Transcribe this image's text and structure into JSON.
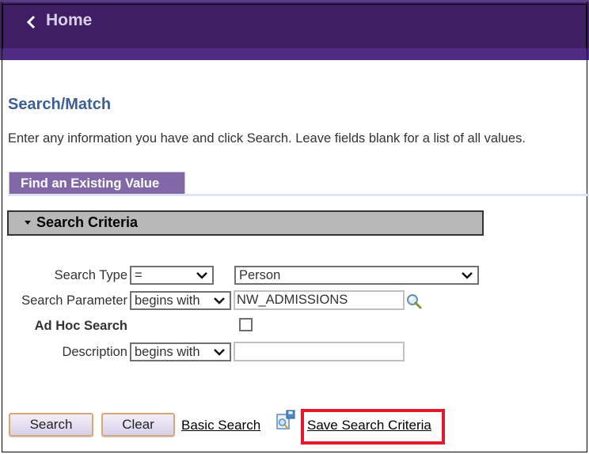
{
  "header": {
    "back_icon": "chevron-left-icon",
    "home_label": "Home"
  },
  "page": {
    "title": "Search/Match",
    "instructions": "Enter any information you have and click Search. Leave fields blank for a list of all values."
  },
  "tabs": [
    {
      "label": "Find an Existing Value",
      "active": true
    }
  ],
  "search_criteria": {
    "section_label": "Search Criteria",
    "expanded": true,
    "fields": {
      "search_type": {
        "label": "Search Type",
        "operator": "=",
        "value": "Person"
      },
      "search_parameter": {
        "label": "Search Parameter",
        "operator": "begins with",
        "value": "NW_ADMISSIONS",
        "lookup_icon": "magnifier-icon"
      },
      "ad_hoc_search": {
        "label": "Ad Hoc Search",
        "checked": false
      },
      "description": {
        "label": "Description",
        "operator": "begins with",
        "value": ""
      }
    }
  },
  "actions": {
    "search_label": "Search",
    "clear_label": "Clear",
    "basic_search_label": "Basic Search",
    "save_icon": "save-search-icon",
    "save_search_criteria_label": "Save Search Criteria"
  },
  "colors": {
    "header_bg": "#3f1e66",
    "header_subbar": "#4f2b84",
    "tab_bg": "#8368a8",
    "title": "#3d5f99",
    "highlight": "#e3182d"
  }
}
